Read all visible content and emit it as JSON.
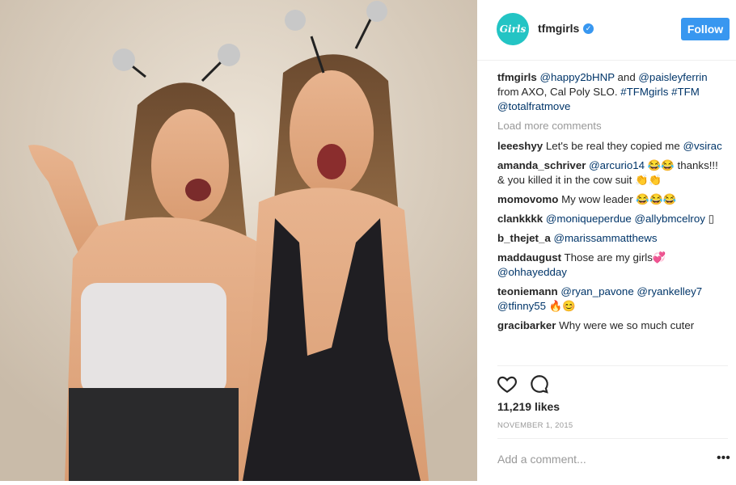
{
  "post": {
    "username": "tfmgirls",
    "avatar_text": "Girls",
    "follow_label": "Follow",
    "caption": {
      "user": "tfmgirls",
      "mention1": "@happy2bHNP",
      "and": "and",
      "mention2": "@paisleyferrin",
      "text": "from AXO, Cal Poly SLO.",
      "tag1": "#TFMgirls",
      "tag2": "#TFM",
      "mention3": "@totalfratmove"
    },
    "load_more": "Load more comments",
    "comments": [
      {
        "user": "leeeshyy",
        "text": "Let's be real they copied me",
        "mention": "@vsirac"
      },
      {
        "user": "amanda_schriver",
        "mention": "@arcurio14",
        "text": "😂😂 thanks!!! & you killed it in the cow suit 👏👏"
      },
      {
        "user": "momovomo",
        "text": "My wow leader 😂😂😂"
      },
      {
        "user": "clankkkk",
        "mention": "@moniqueperdue",
        "mention2": "@allybmcelroy",
        "text": "▯"
      },
      {
        "user": "b_thejet_a",
        "mention": "@marissammatthews"
      },
      {
        "user": "maddaugust",
        "text": "Those are my girls💞",
        "mention": "@ohhayedday"
      },
      {
        "user": "teoniemann",
        "mention": "@ryan_pavone",
        "mention2": "@ryankelley7",
        "mention3": "@tfinny55",
        "text": "🔥😊"
      },
      {
        "user": "gracibarker",
        "text": "Why were we so much cuter"
      }
    ],
    "likes": "11,219 likes",
    "date": "NOVEMBER 1, 2015",
    "add_comment_placeholder": "Add a comment...",
    "more_label": "•••"
  },
  "colors": {
    "accent": "#3897f0",
    "link": "#003569",
    "muted": "#999999"
  },
  "icons": [
    "verified-icon",
    "heart-icon",
    "comment-icon",
    "more-options-icon"
  ]
}
